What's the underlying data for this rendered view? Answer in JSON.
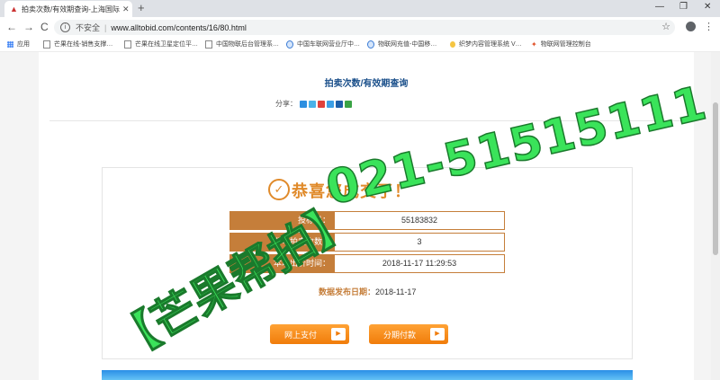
{
  "browser": {
    "tab_title": "拍卖次数/有效期查询-上海国际…",
    "nav": {
      "back": "←",
      "forward": "→",
      "reload": "C"
    },
    "security_label": "不安全",
    "url": "www.alltobid.com/contents/16/80.html",
    "bookmarks": [
      "应用",
      "芒果在线-销售支撑…",
      "芒果在线卫星定位平…",
      "中国物联后台管理系…",
      "中国车联网营业厅中…",
      "物联网充值-中国移…",
      "织梦内容管理系统 V…",
      "物联网管理控制台"
    ]
  },
  "page": {
    "title": "拍卖次数/有效期查询",
    "share_label": "分享：",
    "share_colors": [
      "#2d8fe0",
      "#4bb2e8",
      "#e0423c",
      "#3c9fe6",
      "#1d5ea8",
      "#3aa345"
    ],
    "congrats": "恭喜您成交了！",
    "rows": [
      {
        "label": "投标号：",
        "value": "55183832"
      },
      {
        "label": "参与拍卖次数：",
        "value": "3"
      },
      {
        "label": "本场出价时间：",
        "value": "2018-11-17 11:29:53"
      }
    ],
    "publish_label": "数据发布日期：",
    "publish_date": "2018-11-17",
    "btn_online": "网上支付",
    "btn_installment": "分期付款"
  },
  "watermark": {
    "phone": "021-51515111",
    "brand": "【芒果帮拍】"
  },
  "colors": {
    "accent": "#e08a2a",
    "label_bg": "#c57e3a",
    "watermark": "#3ae35a"
  }
}
